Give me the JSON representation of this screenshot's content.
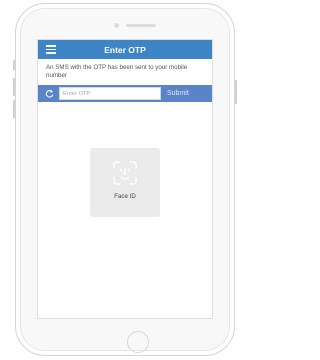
{
  "header": {
    "title": "Enter OTP",
    "menu_icon": "hamburger-menu-icon"
  },
  "sms_note": "An SMS with the OTP has been sent to your mobile number",
  "otp": {
    "refresh_icon": "refresh-icon",
    "placeholder": "Enter OTP",
    "value": "",
    "submit_label": "Submit"
  },
  "face_id": {
    "icon": "face-id-icon",
    "label": "Face ID"
  },
  "colors": {
    "header": "#3d85c6",
    "otp_bar": "#5a84c7",
    "face_card": "#ebebeb"
  }
}
